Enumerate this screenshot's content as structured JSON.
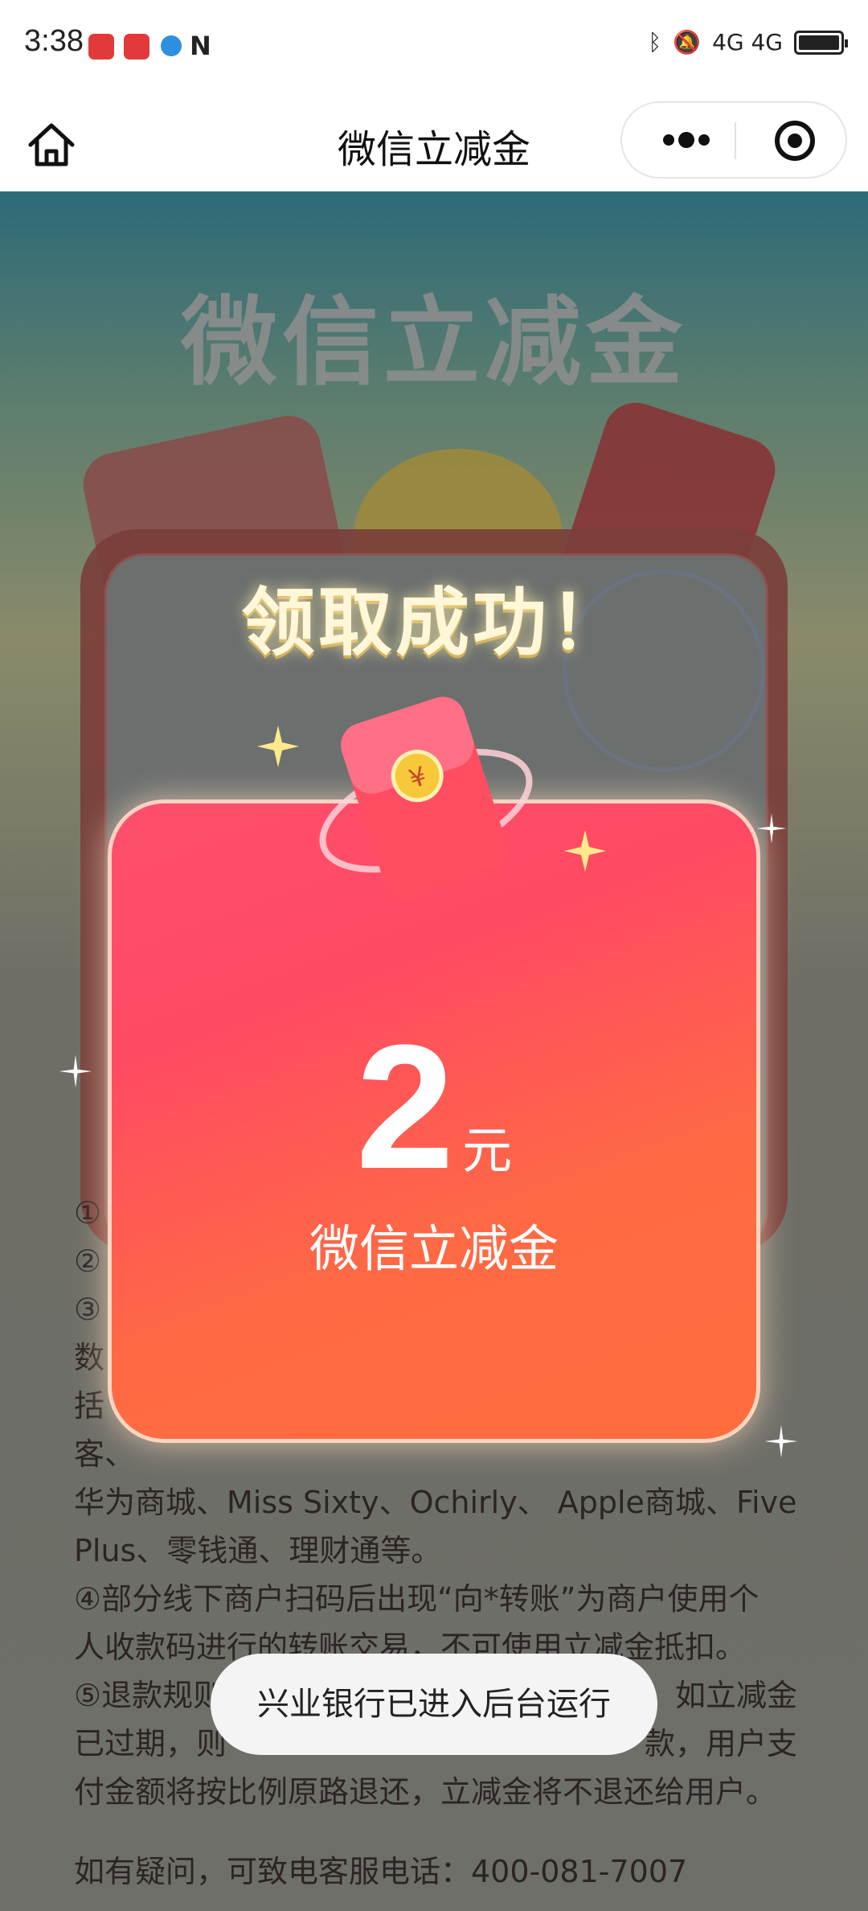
{
  "status_bar": {
    "time": "3:38",
    "right_text": "4G 4G"
  },
  "nav": {
    "title": "微信立减金"
  },
  "page": {
    "heading": "微信立减金",
    "rules_visible_lines": [
      "华为商城、Miss Sixty、Ochirly、 Apple商城、Five",
      "Plus、零钱通、理财通等。",
      "④部分线下商户扫码后出现“向*转账”为商户使用个",
      "人收款码进行的转账交易，不可使用立减金抵扣。"
    ],
    "rules_partial": {
      "refund_start": "⑤退款规则",
      "refund_right": "如立减金",
      "expired_start": "已过期，则",
      "expired_right": "款，用户支",
      "refund_end": "付金额将按比例原路退还，立减金将不退还给用户。"
    },
    "contact": "如有疑问，可致电客服电话：400-081-7007"
  },
  "modal": {
    "title": "领取成功！",
    "amount": "2",
    "unit": "元",
    "subtitle": "微信立减金"
  },
  "toast": {
    "text": "兴业银行已进入后台运行"
  },
  "colors": {
    "card_top": "#ff4f6c",
    "card_bottom": "#ff6d3e",
    "nav_bg": "#ffffff"
  },
  "icons": {
    "home": "home-icon",
    "more": "more-dots-icon",
    "target": "target-icon",
    "envelope": "red-envelope-icon"
  }
}
